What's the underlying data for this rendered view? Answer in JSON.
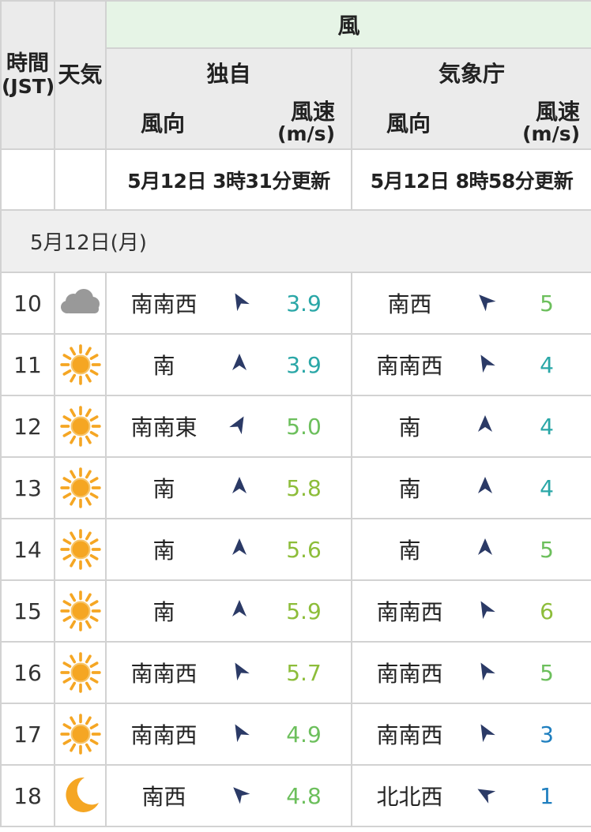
{
  "header": {
    "time_label_1": "時間",
    "time_label_2": "(JST)",
    "weather_label": "天気",
    "wind_label": "風",
    "group_own": "独自",
    "group_jma": "気象庁",
    "dir_label": "風向",
    "speed_label_1": "風速",
    "speed_label_2": "(m/s)",
    "own_updated": "5月12日 3時31分更新",
    "jma_updated": "5月12日 8時58分更新"
  },
  "date_label": "5月12日(月)",
  "colors": {
    "arrow": "#2b3a66",
    "speed_teal": "#2aa7a7",
    "speed_green": "#6cbf5c",
    "speed_lime": "#8dbd3a",
    "speed_blue": "#1f7fbf",
    "sun": "#f5a623",
    "cloud": "#999999",
    "moon": "#f5a623"
  },
  "rows": [
    {
      "time": "10",
      "weather": "cloud-icon",
      "own_dir": "南南西",
      "own_rot": -30,
      "own_speed": "3.9",
      "own_color": "#2aa7a7",
      "jma_dir": "南西",
      "jma_rot": -45,
      "jma_speed": "5",
      "jma_color": "#6cbf5c"
    },
    {
      "time": "11",
      "weather": "sun-icon",
      "own_dir": "南",
      "own_rot": 0,
      "own_speed": "3.9",
      "own_color": "#2aa7a7",
      "jma_dir": "南南西",
      "jma_rot": -30,
      "jma_speed": "4",
      "jma_color": "#2aa7a7"
    },
    {
      "time": "12",
      "weather": "sun-icon",
      "own_dir": "南南東",
      "own_rot": 30,
      "own_speed": "5.0",
      "own_color": "#6cbf5c",
      "jma_dir": "南",
      "jma_rot": 0,
      "jma_speed": "4",
      "jma_color": "#2aa7a7"
    },
    {
      "time": "13",
      "weather": "sun-icon",
      "own_dir": "南",
      "own_rot": 0,
      "own_speed": "5.8",
      "own_color": "#8dbd3a",
      "jma_dir": "南",
      "jma_rot": 0,
      "jma_speed": "4",
      "jma_color": "#2aa7a7"
    },
    {
      "time": "14",
      "weather": "sun-icon",
      "own_dir": "南",
      "own_rot": 0,
      "own_speed": "5.6",
      "own_color": "#8dbd3a",
      "jma_dir": "南",
      "jma_rot": 0,
      "jma_speed": "5",
      "jma_color": "#6cbf5c"
    },
    {
      "time": "15",
      "weather": "sun-icon",
      "own_dir": "南",
      "own_rot": 0,
      "own_speed": "5.9",
      "own_color": "#8dbd3a",
      "jma_dir": "南南西",
      "jma_rot": -30,
      "jma_speed": "6",
      "jma_color": "#8dbd3a"
    },
    {
      "time": "16",
      "weather": "sun-icon",
      "own_dir": "南南西",
      "own_rot": -30,
      "own_speed": "5.7",
      "own_color": "#8dbd3a",
      "jma_dir": "南南西",
      "jma_rot": -30,
      "jma_speed": "5",
      "jma_color": "#6cbf5c"
    },
    {
      "time": "17",
      "weather": "sun-icon",
      "own_dir": "南南西",
      "own_rot": -30,
      "own_speed": "4.9",
      "own_color": "#6cbf5c",
      "jma_dir": "南南西",
      "jma_rot": -30,
      "jma_speed": "3",
      "jma_color": "#1f7fbf"
    },
    {
      "time": "18",
      "weather": "moon-icon",
      "own_dir": "南西",
      "own_rot": -45,
      "own_speed": "4.8",
      "own_color": "#6cbf5c",
      "jma_dir": "北北西",
      "jma_rot": -60,
      "jma_speed": "1",
      "jma_color": "#1f7fbf"
    }
  ]
}
